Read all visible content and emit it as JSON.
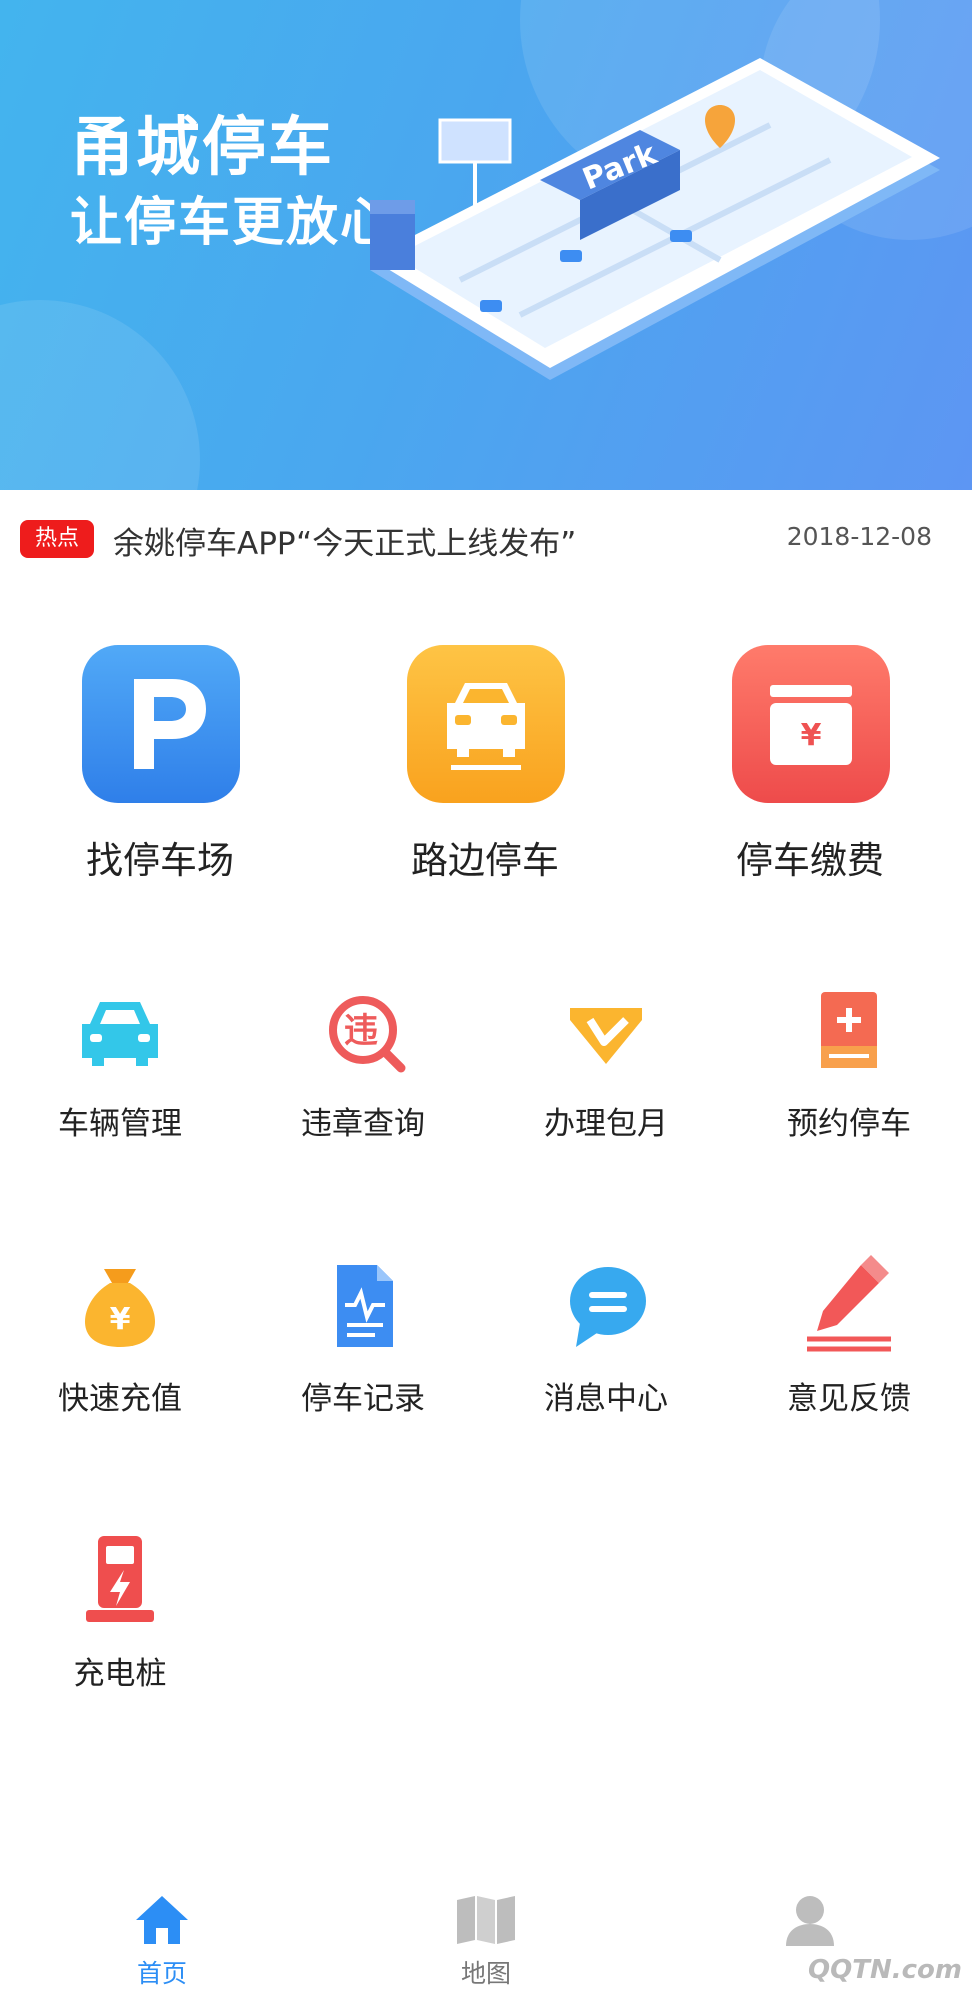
{
  "banner": {
    "title": "甬城停车",
    "slogan": "让停车更放心!",
    "illustration_text": "Park"
  },
  "news": {
    "tag": "热点",
    "headline": "余姚停车APP“今天正式上线发布”",
    "date": "2018-12-08"
  },
  "primary_actions": [
    {
      "label": "找停车场",
      "icon": "parking-p-icon",
      "color": "#3d8df2"
    },
    {
      "label": "路边停车",
      "icon": "car-front-icon",
      "color": "#fdb12a"
    },
    {
      "label": "停车缴费",
      "icon": "wallet-yen-icon",
      "color": "#f25858"
    }
  ],
  "services": [
    {
      "label": "车辆管理",
      "icon": "car-icon"
    },
    {
      "label": "违章查询",
      "icon": "violation-search-icon"
    },
    {
      "label": "办理包月",
      "icon": "vip-diamond-icon"
    },
    {
      "label": "预约停车",
      "icon": "booking-icon"
    },
    {
      "label": "快速充值",
      "icon": "money-bag-icon"
    },
    {
      "label": "停车记录",
      "icon": "record-document-icon"
    },
    {
      "label": "消息中心",
      "icon": "message-bubble-icon"
    },
    {
      "label": "意见反馈",
      "icon": "feedback-pencil-icon"
    },
    {
      "label": "充电桩",
      "icon": "charging-pile-icon"
    }
  ],
  "bottom_nav": [
    {
      "label": "首页",
      "icon": "home-icon",
      "active": true
    },
    {
      "label": "地图",
      "icon": "map-icon",
      "active": false
    },
    {
      "label": "",
      "icon": "user-icon",
      "active": false
    }
  ],
  "watermark": "QQTN.com",
  "colors": {
    "accent": "#2c8ef5",
    "hot_tag": "#ee1c1c"
  }
}
